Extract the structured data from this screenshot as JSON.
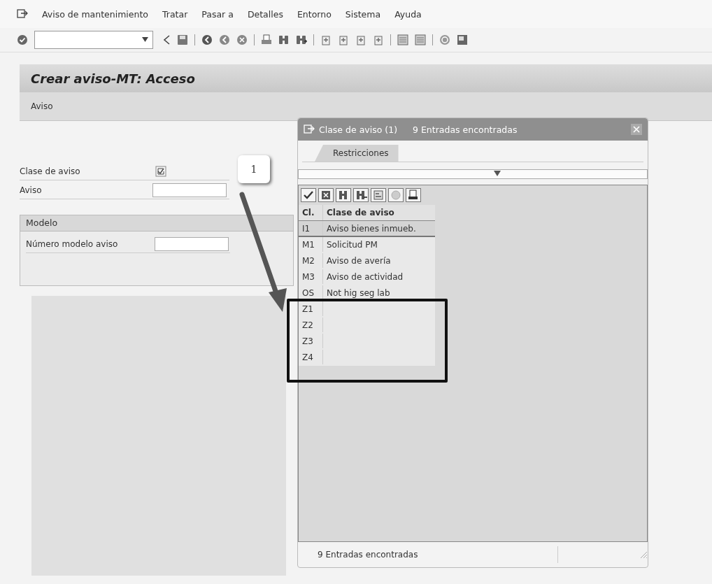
{
  "menu": {
    "items": [
      "Aviso de mantenimiento",
      "Tratar",
      "Pasar a",
      "Detalles",
      "Entorno",
      "Sistema",
      "Ayuda"
    ]
  },
  "screen": {
    "title": "Crear aviso-MT: Acceso",
    "app_toolbar": [
      "Aviso"
    ]
  },
  "fields": [
    {
      "label": "Clase de aviso",
      "kind": "required"
    },
    {
      "label": "Aviso",
      "kind": "input"
    }
  ],
  "group": {
    "title": "Modelo",
    "fields": [
      {
        "label": "Número modelo aviso",
        "kind": "input"
      }
    ]
  },
  "dialog": {
    "title": "Clase de aviso (1)",
    "count": "9 Entradas encontradas",
    "tabs": [
      {
        "label": "Restricciones",
        "selected": true
      }
    ],
    "table": {
      "columns": [
        "Cl.",
        "Clase de aviso"
      ],
      "rows": [
        {
          "cells": [
            "I1",
            "Aviso bienes inmueb."
          ],
          "selected": true
        },
        {
          "cells": [
            "M1",
            "Solicitud PM"
          ],
          "selected": false
        },
        {
          "cells": [
            "M2",
            "Aviso de avería"
          ],
          "selected": false
        },
        {
          "cells": [
            "M3",
            "Aviso de actividad"
          ],
          "selected": false
        },
        {
          "cells": [
            "OS",
            "Not hig seg lab"
          ],
          "selected": false
        },
        {
          "cells": [
            "Z1"
          ],
          "selected": false
        },
        {
          "cells": [
            "Z2"
          ],
          "selected": false
        },
        {
          "cells": [
            "Z3"
          ],
          "selected": false
        },
        {
          "cells": [
            "Z4"
          ],
          "selected": false
        }
      ]
    },
    "status": "9 Entradas encontradas"
  },
  "annotation": {
    "label": "1"
  }
}
